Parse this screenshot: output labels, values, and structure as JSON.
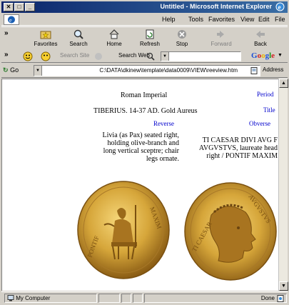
{
  "window": {
    "title": "Untitled - Microsoft Internet Explorer"
  },
  "menu": {
    "items": [
      "File",
      "Edit",
      "View",
      "Favorites",
      "Tools",
      "Help"
    ]
  },
  "toolbar": {
    "back": "Back",
    "forward": "Forward",
    "stop": "Stop",
    "refresh": "Refresh",
    "home": "Home",
    "search": "Search",
    "favorites": "Favorites",
    "chevron": "»"
  },
  "google_bar": {
    "logo": "Google",
    "search_web": "Search Web",
    "search_site": "Search Site"
  },
  "address": {
    "label": "Address",
    "value": "C:\\DATA\\dkinew\\template\\data0009\\VIEW\\reeview.htm",
    "go": "Go"
  },
  "page": {
    "labels": {
      "period": "Period",
      "title": "Title",
      "obverse": "Obverse",
      "reverse": "Reverse"
    },
    "period_value": "Roman Imperial",
    "title_value": "TIBERIUS. 14-37 AD. Gold Aureus",
    "obverse_value": [
      "TI CAESAR DIVI AVG F",
      "AVGVSTVS, laureate head",
      "right / PONTIF MAXIM"
    ],
    "reverse_value": [
      "Livia (as Pax) seated right,",
      "holding olive-branch and",
      "long vertical sceptre; chair",
      "legs ornate."
    ]
  },
  "status": {
    "left": "Done",
    "zone": "My Computer"
  },
  "colors": {
    "title_bar": "#0a246a",
    "label_blue": "#0000cc",
    "gold": "#c9a035"
  }
}
